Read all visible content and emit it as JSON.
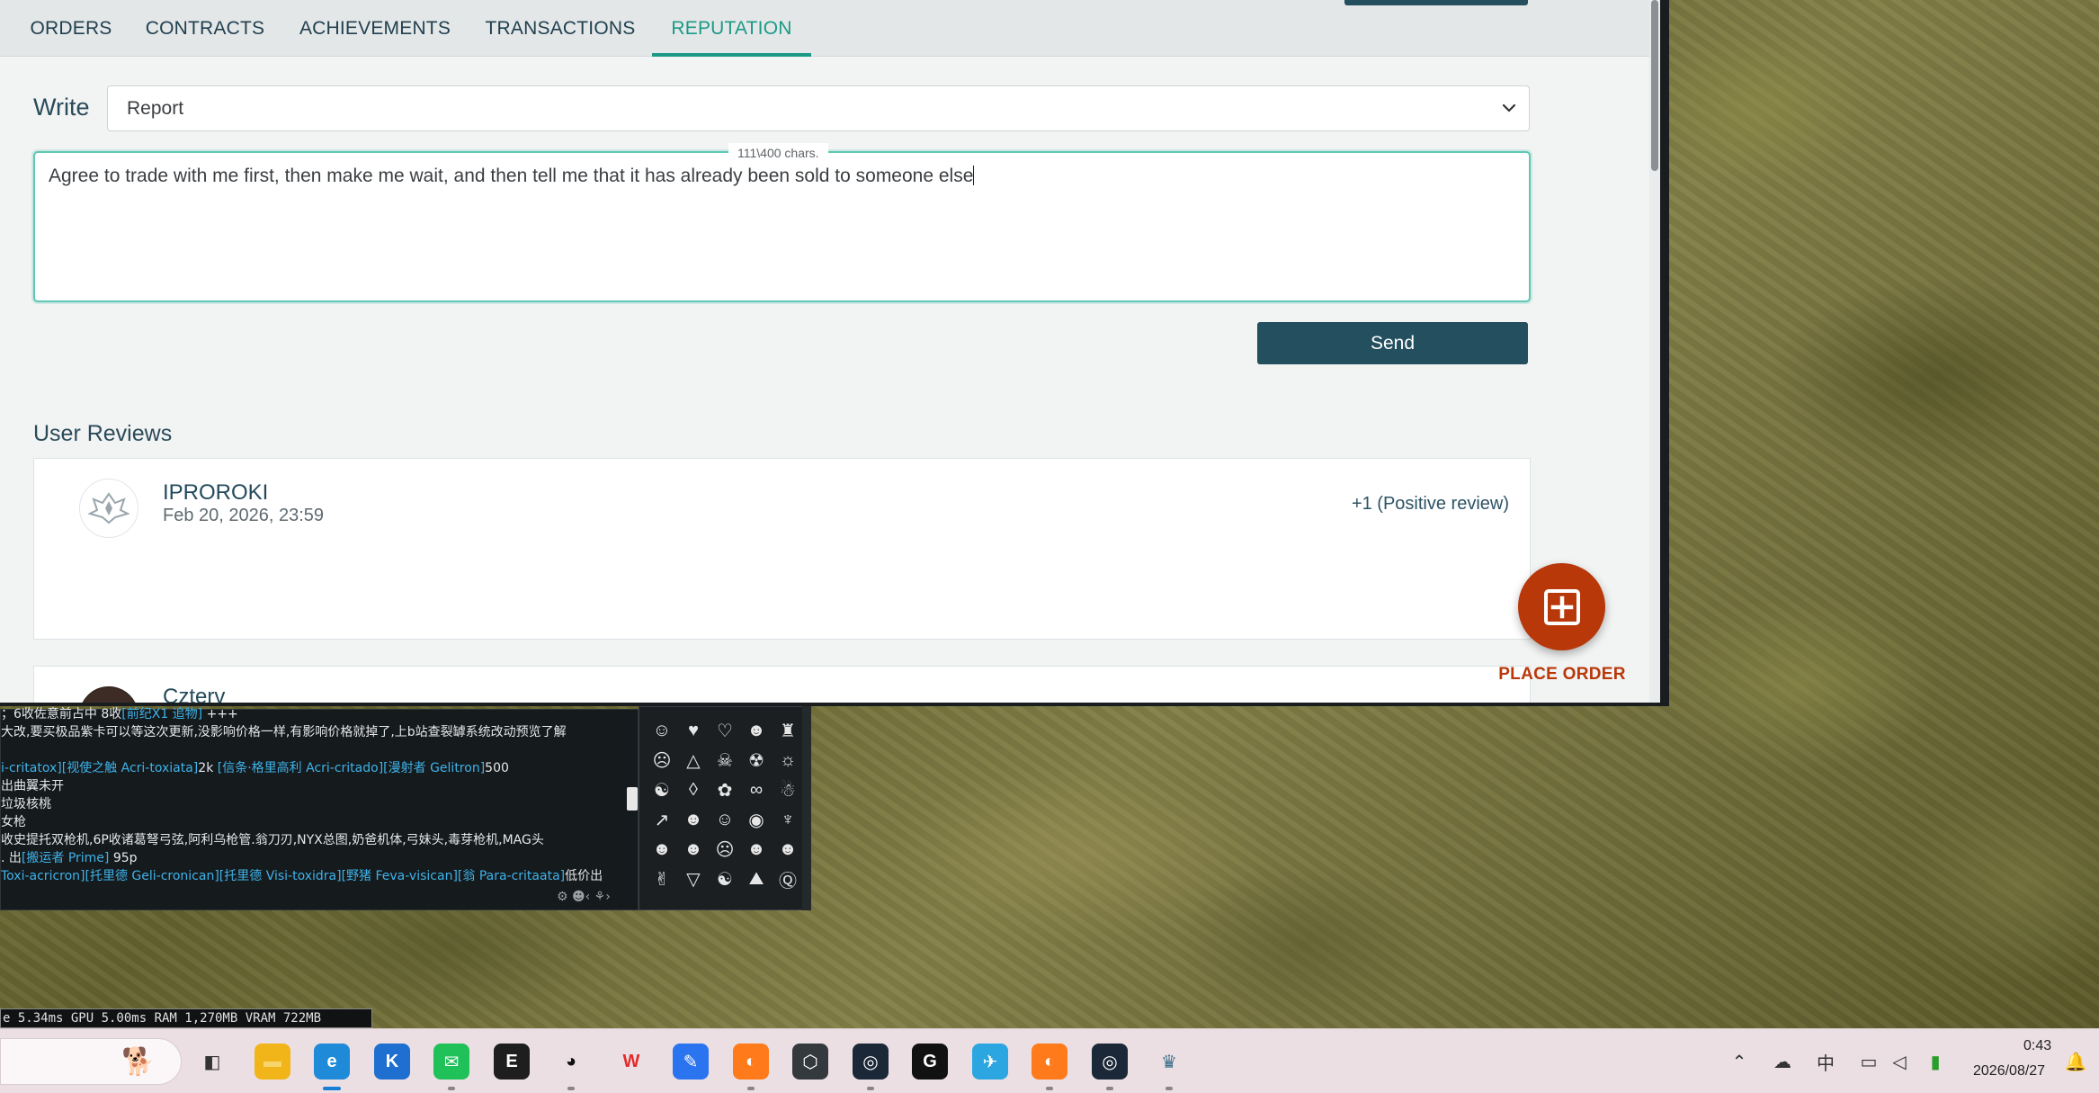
{
  "nav": {
    "tabs": [
      {
        "label": "ORDERS",
        "active": false
      },
      {
        "label": "CONTRACTS",
        "active": false
      },
      {
        "label": "ACHIEVEMENTS",
        "active": false
      },
      {
        "label": "TRANSACTIONS",
        "active": false
      },
      {
        "label": "REPUTATION",
        "active": true
      }
    ]
  },
  "write": {
    "label": "Write",
    "selected_type": "Report",
    "char_counter": "111\\400 chars.",
    "text_value": "Agree to trade with me first, then make me wait, and then tell me that it has already been sold to someone else",
    "send_label": "Send"
  },
  "reviews": {
    "title": "User Reviews",
    "items": [
      {
        "user": "IPROROKI",
        "date": "Feb 20, 2026, 23:59",
        "score": "+1 (Positive review)"
      },
      {
        "user": "Czterv",
        "date": "",
        "score": ""
      }
    ]
  },
  "place_order": {
    "label": "PLACE ORDER"
  },
  "game_chat": {
    "lines": [
      [
        {
          "t": "；6收佐意前占中 8收",
          "link": false
        },
        {
          "t": "[前纪X1 追物]",
          "link": true
        },
        {
          "t": " +++",
          "link": false
        }
      ],
      [
        {
          "t": "大改,要买极品紫卡可以等这次更新,没影响价格一样,有影响价格就掉了,上b站查裂罅系统改动预览了解",
          "link": false
        }
      ],
      [],
      [
        {
          "t": "i-critatox][",
          "link": true
        },
        {
          "t": "视使之触 Acri-toxiata]",
          "link": true
        },
        {
          "t": "2k  ",
          "link": false
        },
        {
          "t": "[信条·格里高利 Acri-critado][漫射者 Gelitron]",
          "link": true
        },
        {
          "t": "500",
          "link": false
        }
      ],
      [
        {
          "t": "出曲翼未开",
          "link": false
        }
      ],
      [
        {
          "t": "垃圾核桃",
          "link": false
        }
      ],
      [
        {
          "t": "女枪",
          "link": false
        }
      ],
      [
        {
          "t": "收史提托双枪机,6P收诸葛弩弓弦,阿利乌枪管.翁刀刃,NYX总图,奶爸机体,弓妹头,毒芽枪机,MAG头",
          "link": false
        }
      ],
      [
        {
          "t": ". 出",
          "link": false
        },
        {
          "t": "[搬运者 Prime]",
          "link": true
        },
        {
          "t": " 95p",
          "link": false
        }
      ],
      [
        {
          "t": "Toxi-acricron][托里德 Geli-cronican][托里德 Visi-toxidra][野猪 Feva-visican][翁 Para-critaata]",
          "link": true
        },
        {
          "t": "低价出",
          "link": false
        }
      ]
    ]
  },
  "emoji_panel": {
    "glyphs": [
      "☺",
      "♥",
      "♡",
      "☻",
      "♜",
      "☹",
      "△",
      "☠",
      "☢",
      "☼",
      "☯",
      "◊",
      "✿",
      "∞",
      "☃",
      "↗",
      "☻",
      "☺",
      "◉",
      "♆",
      "☻",
      "☻",
      "☹",
      "☻",
      "☻",
      "✌",
      "▽",
      "☯",
      "⛰",
      "Ⓠ"
    ]
  },
  "perf": {
    "text": "e 5.34ms GPU 5.00ms RAM 1,270MB VRAM 722MB"
  },
  "taskbar": {
    "apps": [
      {
        "name": "task-view",
        "glyph": "◧",
        "bg": "#ebdfe3",
        "fg": "#333333"
      },
      {
        "name": "file-explorer",
        "glyph": "▬",
        "bg": "#f2b519",
        "fg": "#f8d56b"
      },
      {
        "name": "edge",
        "glyph": "e",
        "bg": "#1f8ad8",
        "fg": "#ffffff"
      },
      {
        "name": "kk-app",
        "glyph": "K",
        "bg": "#1f6fd0",
        "fg": "#ffffff"
      },
      {
        "name": "wechat",
        "glyph": "✉",
        "bg": "#21c15a",
        "fg": "#ffffff"
      },
      {
        "name": "epic-games",
        "glyph": "E",
        "bg": "#1e1e1e",
        "fg": "#ffffff"
      },
      {
        "name": "qq",
        "glyph": "◕",
        "bg": "#ebdfe3",
        "fg": "#111111"
      },
      {
        "name": "wps",
        "glyph": "W",
        "bg": "#ebdfe3",
        "fg": "#e22b2b"
      },
      {
        "name": "feishu",
        "glyph": "✎",
        "bg": "#2a74f0",
        "fg": "#ffffff"
      },
      {
        "name": "browser-orange",
        "glyph": "◐",
        "bg": "#ff7a1a",
        "fg": "#ffffff"
      },
      {
        "name": "cube-app",
        "glyph": "⬡",
        "bg": "#34393e",
        "fg": "#ffffff"
      },
      {
        "name": "steam",
        "glyph": "◎",
        "bg": "#1b2838",
        "fg": "#ffffff"
      },
      {
        "name": "g-app",
        "glyph": "G",
        "bg": "#111111",
        "fg": "#ffffff"
      },
      {
        "name": "plane-app",
        "glyph": "✈",
        "bg": "#2ba6e0",
        "fg": "#ffffff"
      },
      {
        "name": "browser-orange-2",
        "glyph": "◐",
        "bg": "#ff7a1a",
        "fg": "#ffffff"
      },
      {
        "name": "steam-2",
        "glyph": "◎",
        "bg": "#1b2838",
        "fg": "#ffffff"
      },
      {
        "name": "warframe",
        "glyph": "♛",
        "bg": "#ebdfe3",
        "fg": "#3b6d88"
      }
    ],
    "tray": {
      "ime": "中",
      "time": "0:43",
      "date": "2026/08/27"
    }
  }
}
